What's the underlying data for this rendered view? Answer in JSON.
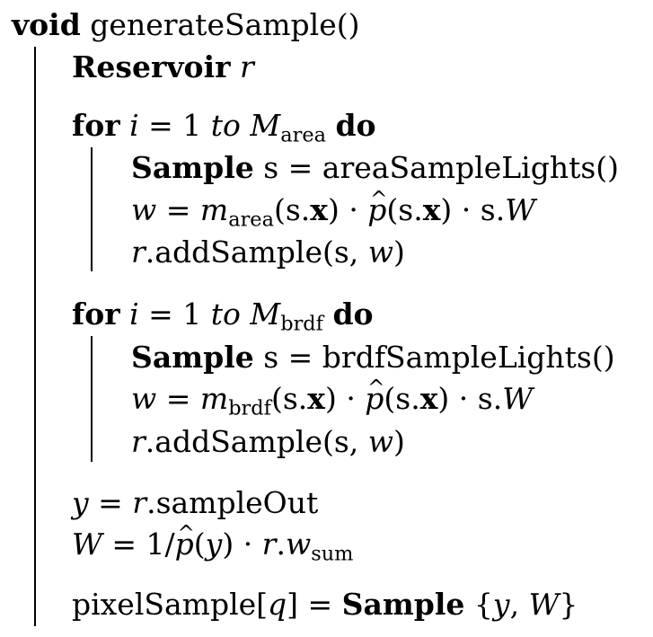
{
  "algorithm": {
    "fn_kw": "void",
    "fn_name": "generateSample()",
    "decl_kw": "Reservoir",
    "decl_var": "r",
    "loop_area": {
      "kw_for": "for",
      "iter": "i",
      "eq": " = 1 ",
      "to": "to",
      "bound_base": "M",
      "bound_sub": "area",
      "kw_do": "do",
      "s1_kw": "Sample",
      "s1_rest": " s = areaSampleLights()",
      "s2_w": "w",
      "s2_eq": " = ",
      "s2_m": "m",
      "s2_msub": "area",
      "s2_open": "(s.",
      "s2_x": "x",
      "s2_mid": ") · ",
      "s2_p": "p",
      "s2_open2": "(s.",
      "s2_x2": "x",
      "s2_tail": ") · s.",
      "s2_W": "W",
      "s3_r": "r",
      "s3_call": ".addSample(s, ",
      "s3_w": "w",
      "s3_close": ")"
    },
    "loop_brdf": {
      "kw_for": "for",
      "iter": "i",
      "eq": " = 1 ",
      "to": "to",
      "bound_base": "M",
      "bound_sub": "brdf",
      "kw_do": "do",
      "s1_kw": "Sample",
      "s1_rest": " s = brdfSampleLights()",
      "s2_w": "w",
      "s2_eq": " = ",
      "s2_m": "m",
      "s2_msub": "brdf",
      "s2_open": "(s.",
      "s2_x": "x",
      "s2_mid": ") · ",
      "s2_p": "p",
      "s2_open2": "(s.",
      "s2_x2": "x",
      "s2_tail": ") · s.",
      "s2_W": "W",
      "s3_r": "r",
      "s3_call": ".addSample(s, ",
      "s3_w": "w",
      "s3_close": ")"
    },
    "out": {
      "y": "y",
      "eq": " = ",
      "r": "r",
      "field": ".sampleOut"
    },
    "weight": {
      "W": "W",
      "eq_frac": " = 1/",
      "p": "p",
      "open": "(",
      "y": "y",
      "close": ") · ",
      "r": "r",
      "dot": ".",
      "w": "w",
      "wsub": "sum"
    },
    "assign": {
      "lhs": "pixelSample[",
      "q": "q",
      "lhs_close": "] = ",
      "kw": "Sample",
      "open": " {",
      "y": "y",
      "comma": ", ",
      "W": "W",
      "close": "}"
    }
  }
}
